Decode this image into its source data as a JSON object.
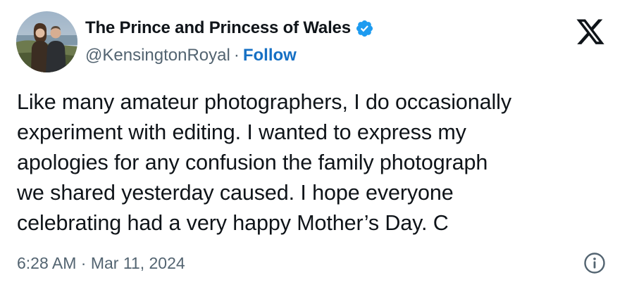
{
  "author": {
    "display_name": "The Prince and Princess of Wales",
    "handle": "@KensingtonRoyal",
    "separator": "·",
    "follow_label": "Follow",
    "verified": true
  },
  "tweet": {
    "text": "Like many amateur photographers, I do occasionally\nexperiment with editing. I wanted to express my\napologies for any confusion the family photograph\nwe shared yesterday caused. I hope everyone\ncelebrating had a very happy Mother’s Day. C",
    "timestamp": "6:28 AM · Mar 11, 2024"
  },
  "icons": {
    "logo": "x-logo-icon",
    "verified": "verified-badge-icon",
    "info": "info-icon"
  },
  "colors": {
    "text": "#0f1419",
    "secondary": "#536471",
    "link": "#1670c4",
    "verified": "#1d9bf0"
  }
}
